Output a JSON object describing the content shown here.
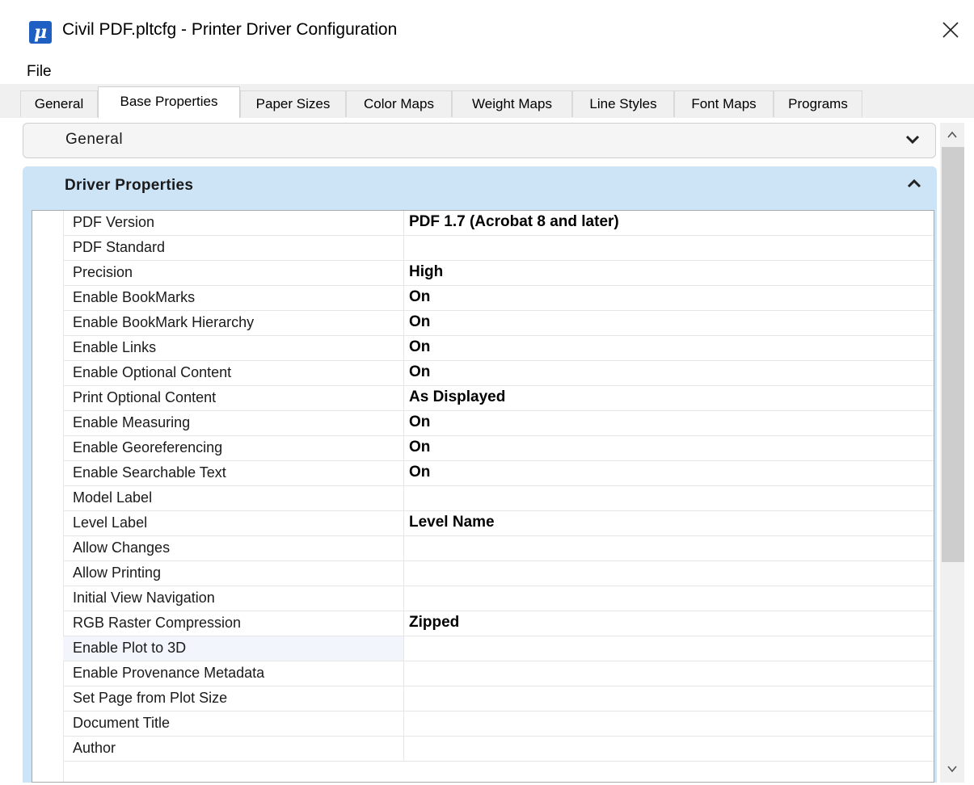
{
  "window": {
    "title": "Civil PDF.pltcfg - Printer Driver Configuration",
    "icon": "microstation-logo-icon",
    "close_icon": "close-icon"
  },
  "menu": {
    "file": "File"
  },
  "tabs": [
    {
      "label": "General",
      "active": false
    },
    {
      "label": "Base Properties",
      "active": true
    },
    {
      "label": "Paper Sizes",
      "active": false
    },
    {
      "label": "Color Maps",
      "active": false
    },
    {
      "label": "Weight Maps",
      "active": false
    },
    {
      "label": "Line Styles",
      "active": false
    },
    {
      "label": "Font Maps",
      "active": false
    },
    {
      "label": "Programs",
      "active": false
    }
  ],
  "sections": {
    "general": {
      "label": "General",
      "expanded": false
    },
    "driver": {
      "label": "Driver Properties",
      "expanded": true
    }
  },
  "properties": [
    {
      "name": "PDF Version",
      "value": "PDF 1.7 (Acrobat 8 and later)"
    },
    {
      "name": "PDF Standard",
      "value": ""
    },
    {
      "name": "Precision",
      "value": "High"
    },
    {
      "name": "Enable BookMarks",
      "value": "On"
    },
    {
      "name": "Enable BookMark Hierarchy",
      "value": "On"
    },
    {
      "name": "Enable Links",
      "value": "On"
    },
    {
      "name": "Enable Optional Content",
      "value": "On"
    },
    {
      "name": "Print Optional Content",
      "value": "As Displayed"
    },
    {
      "name": "Enable Measuring",
      "value": "On"
    },
    {
      "name": "Enable Georeferencing",
      "value": "On"
    },
    {
      "name": "Enable Searchable Text",
      "value": "On"
    },
    {
      "name": "Model Label",
      "value": ""
    },
    {
      "name": "Level Label",
      "value": "Level Name"
    },
    {
      "name": "Allow Changes",
      "value": ""
    },
    {
      "name": "Allow Printing",
      "value": ""
    },
    {
      "name": "Initial View Navigation",
      "value": ""
    },
    {
      "name": "RGB Raster Compression",
      "value": "Zipped"
    },
    {
      "name": "Enable Plot to 3D",
      "value": ""
    },
    {
      "name": "Enable Provenance Metadata",
      "value": ""
    },
    {
      "name": "Set Page from Plot Size",
      "value": ""
    },
    {
      "name": "Document Title",
      "value": ""
    },
    {
      "name": "Author",
      "value": ""
    }
  ],
  "colors": {
    "section_header_bg": "#cde4f7",
    "icon_blue": "#1f5fc4",
    "tabstrip_bg": "#f0f0f0"
  }
}
